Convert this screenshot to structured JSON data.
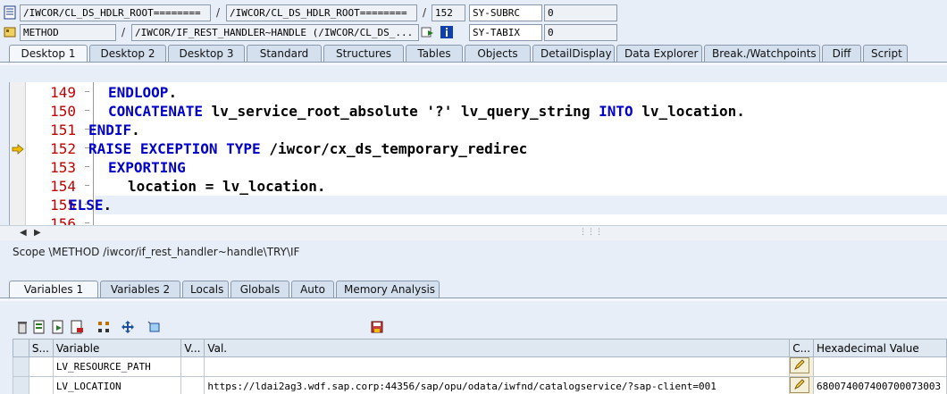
{
  "header": {
    "row1": {
      "class_field": "/IWCOR/CL_DS_HDLR_ROOT========",
      "sep1": "/",
      "include_field": "/IWCOR/CL_DS_HDLR_ROOT========",
      "sep2": "/",
      "line_field": "152",
      "sysvar_label": "SY-SUBRC",
      "sysvar_value": "0"
    },
    "row2": {
      "type_field": "METHOD",
      "sep1": "/",
      "name_field": "/IWCOR/IF_REST_HANDLER~HANDLE (/IWCOR/CL_DS_...",
      "sysvar_label": "SY-TABIX",
      "sysvar_value": "0"
    }
  },
  "top_tabs": [
    "Desktop 1",
    "Desktop 2",
    "Desktop 3",
    "Standard",
    "Structures",
    "Tables",
    "Objects",
    "DetailDisplay",
    "Data Explorer",
    "Break./Watchpoints",
    "Diff",
    "Script"
  ],
  "editor": {
    "lines": [
      {
        "no": "149",
        "code": "ENDLOOP."
      },
      {
        "no": "150",
        "code": "CONCATENATE lv_service_root_absolute '?' lv_query_string INTO lv_location."
      },
      {
        "no": "151",
        "code": "ENDIF."
      },
      {
        "no": "152",
        "code": "RAISE EXCEPTION TYPE /iwcor/cx_ds_temporary_redirec"
      },
      {
        "no": "153",
        "code": "EXPORTING"
      },
      {
        "no": "154",
        "code": "location = lv_location."
      },
      {
        "no": "155",
        "code": "ELSE."
      },
      {
        "no": "156",
        "code": ""
      }
    ],
    "current_line": "152"
  },
  "scope_text": "Scope \\METHOD /iwcor/if_rest_handler~handle\\TRY\\IF",
  "var_tabs": [
    "Variables 1",
    "Variables 2",
    "Locals",
    "Globals",
    "Auto",
    "Memory Analysis"
  ],
  "grid": {
    "headers": [
      "S...",
      "Variable",
      "V...",
      "Val.",
      "C...",
      "Hexadecimal Value"
    ],
    "rows": [
      {
        "variable": "LV_RESOURCE_PATH",
        "value": "",
        "hex": ""
      },
      {
        "variable": "LV_LOCATION",
        "value": "https://ldai2ag3.wdf.sap.corp:44356/sap/opu/odata/iwfnd/catalogservice/?sap-client=001",
        "hex": "680074007400700073003"
      }
    ]
  },
  "colors": {
    "background": "#e7eef7",
    "keyword": "#0000c8",
    "line_number": "#c00000",
    "current_line": "#e8eff8"
  }
}
